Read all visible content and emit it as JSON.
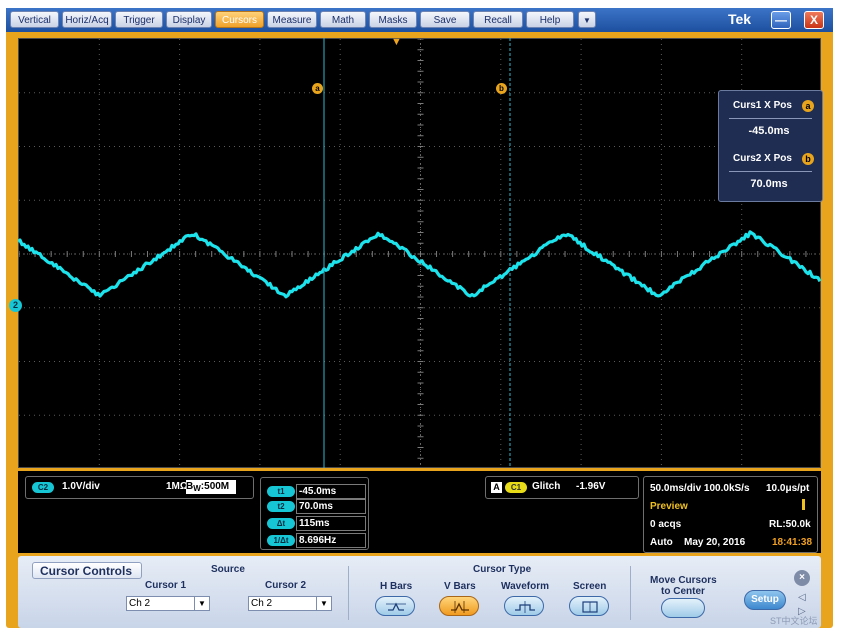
{
  "menubar": {
    "items": [
      "Vertical",
      "Horiz/Acq",
      "Trigger",
      "Display",
      "Cursors",
      "Measure",
      "Math",
      "Masks",
      "Save",
      "Recall",
      "Help",
      "▼"
    ],
    "active": "Cursors",
    "brand": "Tek",
    "minimize_glyph": "—",
    "close_glyph": "X"
  },
  "screen": {
    "cursor_a_label": "a",
    "cursor_b_label": "b",
    "trigger_marker": "▼",
    "channel_marker": "2",
    "waveform_color": "#1de3ec",
    "cursor_color": "#2fb7d0"
  },
  "readout": {
    "curs1_label": "Curs1 X Pos",
    "curs1_badge": "a",
    "curs1_value": "-45.0ms",
    "curs2_label": "Curs2 X Pos",
    "curs2_badge": "b",
    "curs2_value": "70.0ms"
  },
  "status": {
    "channel_badge": "C2",
    "vdiv": "1.0V/div",
    "impedance": "1MΩ",
    "bandwidth_prefix": "B",
    "bandwidth_sub": "W",
    "bandwidth_value": ":500M",
    "cursor_table": [
      {
        "tag": "t1",
        "value": "-45.0ms"
      },
      {
        "tag": "t2",
        "value": "70.0ms"
      },
      {
        "tag": "Δt",
        "value": "115ms"
      },
      {
        "tag": "1/Δt",
        "value": "8.696Hz"
      }
    ],
    "trigger_mode": "A",
    "trigger_channel": "C1",
    "trigger_type": "Glitch",
    "trigger_level": "-1.96V",
    "timebase": "50.0ms/div 100.0kS/s",
    "time_per_point": "10.0μs/pt",
    "preview": "Preview",
    "acqs": "0 acqs",
    "record_length": "RL:50.0k",
    "mode": "Auto",
    "date": "May 20, 2016",
    "time": "18:41:38"
  },
  "panel": {
    "title": "Cursor Controls",
    "source_label": "Source",
    "cursor1_label": "Cursor 1",
    "cursor1_value": "Ch 2",
    "cursor2_label": "Cursor 2",
    "cursor2_value": "Ch 2",
    "cursor_type_label": "Cursor Type",
    "types": [
      "H Bars",
      "V Bars",
      "Waveform",
      "Screen"
    ],
    "active_type": "V Bars",
    "move_label_line1": "Move Cursors",
    "move_label_line2": "to Center",
    "setup_label": "Setup",
    "watermark": "ST中文论坛"
  }
}
